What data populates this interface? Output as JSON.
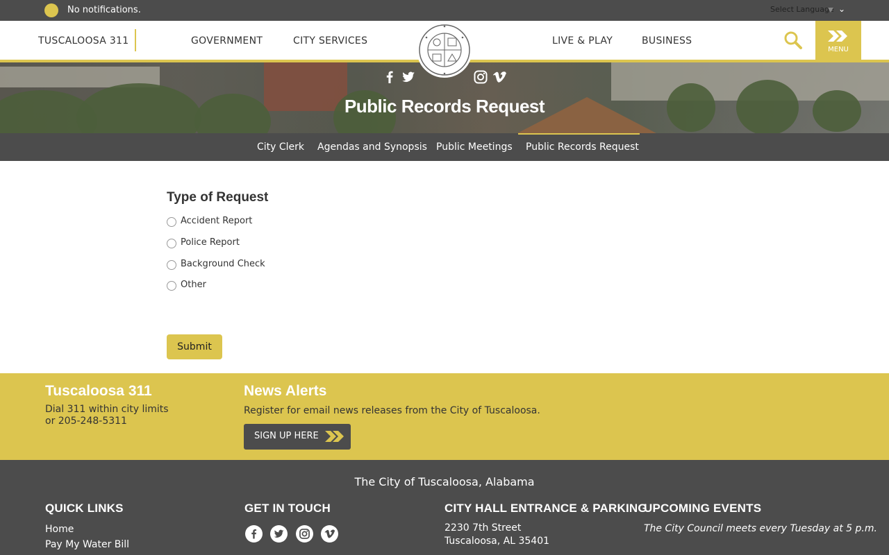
{
  "notification": {
    "text": "No notifications."
  },
  "language": {
    "label": "Select Language"
  },
  "header": {
    "brand": "TUSCALOOSA 311",
    "nav": [
      "GOVERNMENT",
      "CITY SERVICES",
      "LIVE & PLAY",
      "BUSINESS"
    ],
    "menu_label": "MENU"
  },
  "hero": {
    "title": "Public Records Request"
  },
  "subnav": {
    "items": [
      "City Clerk",
      "Agendas and Synopsis",
      "Public Meetings",
      "Public Records Request"
    ],
    "active": "Public Records Request"
  },
  "form": {
    "title": "Type of Request",
    "options": [
      "Accident Report",
      "Police Report",
      "Background Check",
      "Other"
    ],
    "submit_label": "Submit"
  },
  "band": {
    "t311_title": "Tuscaloosa 311",
    "t311_line1": "Dial 311 within city limits",
    "t311_line2": "or 205-248-5311",
    "news_title": "News Alerts",
    "news_text": "Register for email news releases from the City of Tuscaloosa.",
    "signup_label": "SIGN UP HERE"
  },
  "footer": {
    "city": "The City of Tuscaloosa, Alabama",
    "quick_links_title": "QUICK LINKS",
    "quick_links": [
      "Home",
      "Pay My Water Bill"
    ],
    "get_in_touch_title": "GET IN TOUCH",
    "parking_title": "CITY HALL ENTRANCE & PARKING",
    "address_line1": "2230 7th Street",
    "address_line2": "Tuscaloosa, AL 35401",
    "events_title": "UPCOMING EVENTS",
    "events_text": "The City Council meets every Tuesday at 5 p.m."
  },
  "icons": {
    "notification": "notification-dot-icon",
    "search": "search-icon",
    "menu": "chevron-right-icon",
    "social": [
      "facebook-icon",
      "twitter-icon",
      "instagram-icon",
      "vimeo-icon"
    ]
  },
  "colors": {
    "accent": "#dcc54f",
    "dark": "#4c4c4c"
  }
}
